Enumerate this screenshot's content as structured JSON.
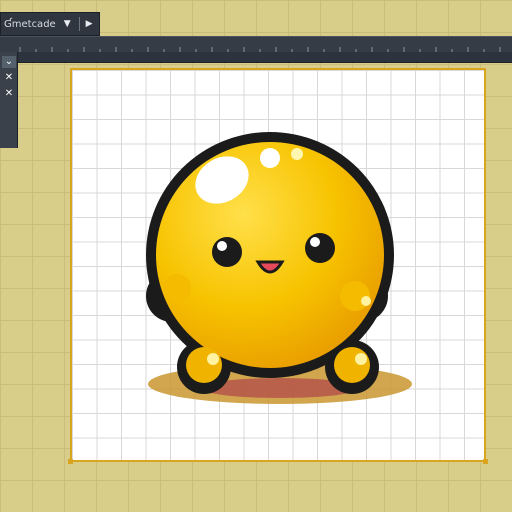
{
  "toolbar": {
    "title": "Ɠmetcade",
    "dropdown_icon": "triangle-down-icon",
    "play_icon": "play-icon"
  },
  "side_panel": {
    "tools": [
      {
        "icon": "check-down-icon",
        "glyph": "⌄",
        "active": true
      },
      {
        "icon": "cross-icon",
        "glyph": "✕",
        "active": false
      },
      {
        "icon": "cross-icon",
        "glyph": "✕",
        "active": false
      }
    ]
  },
  "colors": {
    "workspace": "#d9cd8a",
    "panel": "#2f3640",
    "canvas_border": "#d9a520",
    "sprite_body": "#f5c400",
    "sprite_outline": "#1b1b1b"
  },
  "sprite": {
    "name": "yellow-blob-character"
  }
}
